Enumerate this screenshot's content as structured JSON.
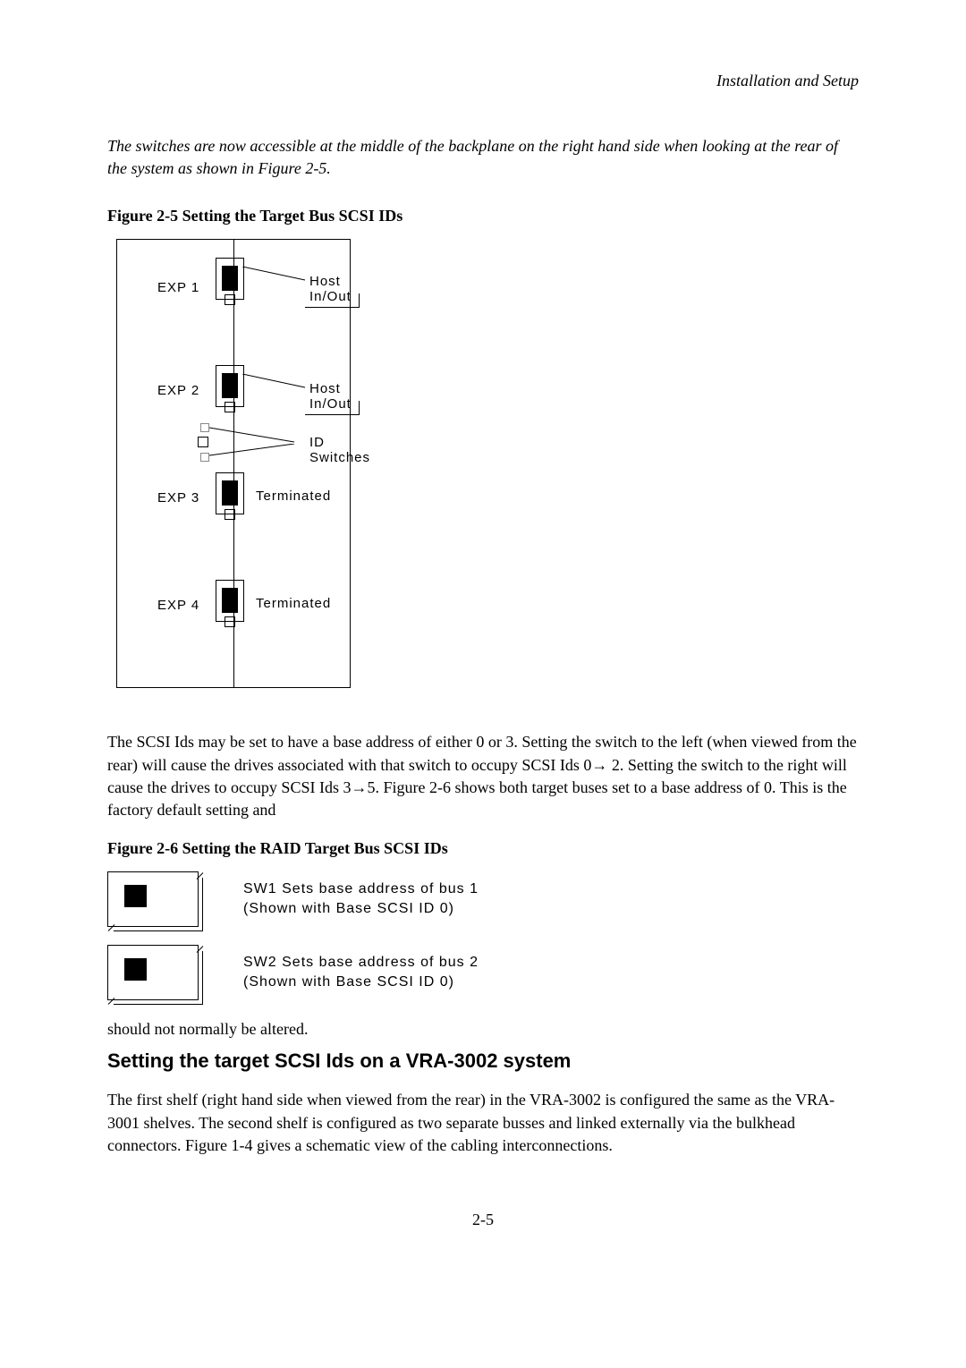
{
  "header": {
    "section_title": "Installation and Setup"
  },
  "intro": {
    "text": "The switches are  now accessible at the middle of the backplane on the right hand side when looking at the rear of the system as shown in Figure 2-5."
  },
  "figure25": {
    "caption": "Figure 2-5 Setting the Target Bus SCSI IDs",
    "labels": {
      "exp1": "EXP 1",
      "exp2": "EXP 2",
      "exp3": "EXP 3",
      "exp4": "EXP 4",
      "host1": "Host In/Out",
      "host2": "Host In/Out",
      "idswitches": "ID Switches",
      "term1": "Terminated",
      "term2": "Terminated"
    }
  },
  "para1": {
    "text": "The SCSI Ids may be set to have a base address of either 0 or 3. Setting the switch to the left (when viewed from the rear) will cause the drives associated with that switch to occupy SCSI Ids 0→ 2. Setting the switch to the right will cause the drives to occupy SCSI Ids 3→5. Figure 2-6 shows both target buses set to a base address of 0. This is the factory default setting and"
  },
  "figure26": {
    "caption": "Figure 2-6 Setting the RAID Target Bus SCSI IDs",
    "sw1": {
      "line1": "SW1 Sets base address of bus 1",
      "line2": "(Shown with Base SCSI ID 0)"
    },
    "sw2": {
      "line1": "SW2 Sets base address of bus 2",
      "line2": "(Shown with Base SCSI ID 0)"
    }
  },
  "para2": {
    "text": "should not normally be altered."
  },
  "heading2": {
    "text": "Setting the target SCSI Ids on a VRA-3002 system"
  },
  "para3": {
    "text": "The first shelf (right hand side when viewed from the rear) in the VRA-3002 is configured the same as  the VRA-3001 shelves. The second shelf is configured as two separate busses and linked externally via the bulkhead connectors. Figure 1-4 gives a schematic view of the cabling interconnections."
  },
  "footer": {
    "page_number": "2-5"
  }
}
